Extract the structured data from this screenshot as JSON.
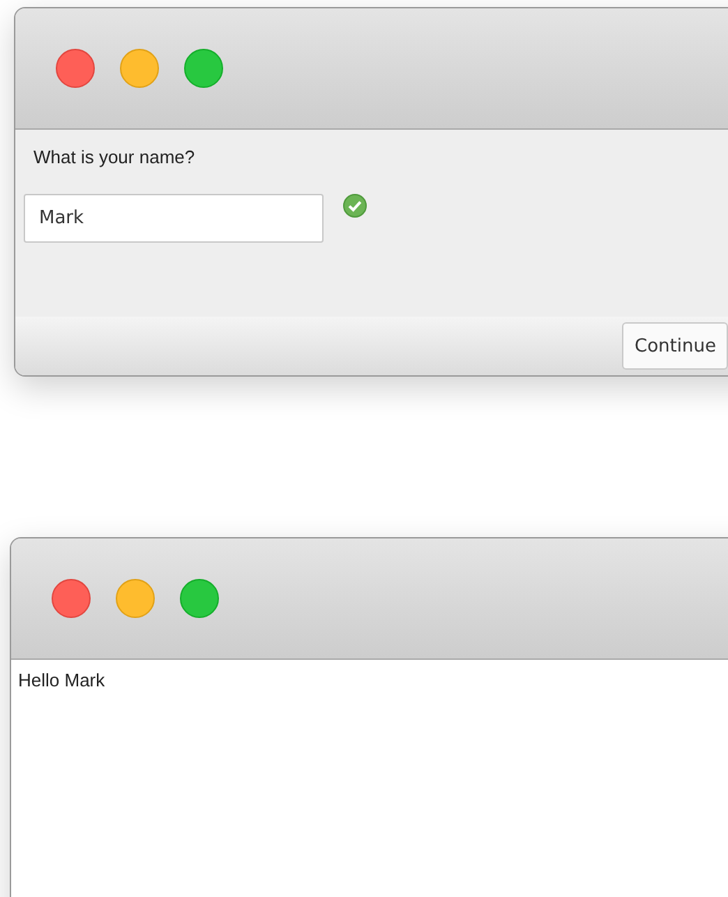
{
  "windows": [
    {
      "kind": "dialog",
      "prompt": "What is your name?",
      "field": {
        "value": "Mark",
        "valid": true
      },
      "buttons": [
        "Continue"
      ]
    },
    {
      "kind": "output",
      "message": "Hello Mark"
    }
  ]
}
